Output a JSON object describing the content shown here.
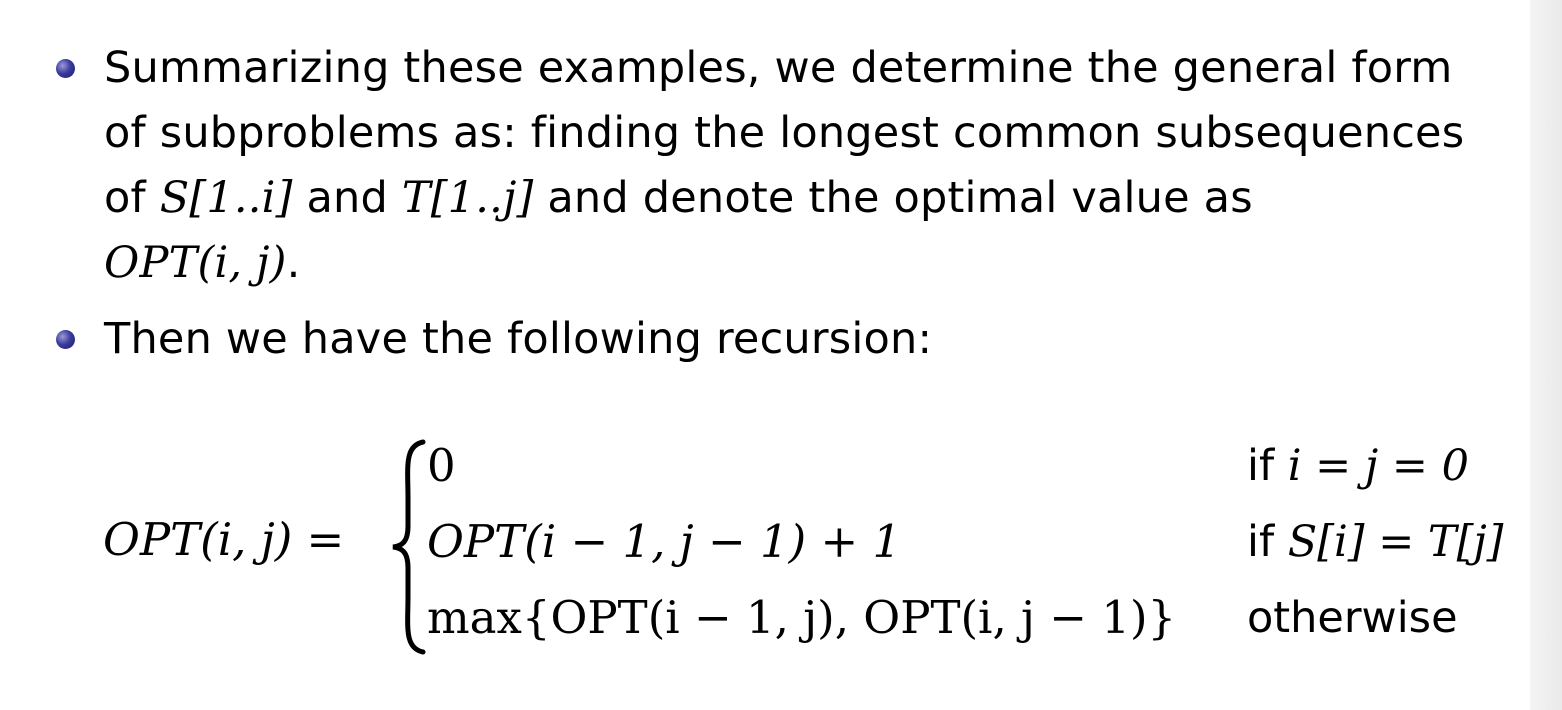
{
  "bullets": [
    {
      "line1": "Summarizing these examples, we determine the general form",
      "line2": "of subproblems as: finding the longest common subsequences",
      "line3_a": "of ",
      "line3_m1": "S[1..i]",
      "line3_b": " and ",
      "line3_m2": "T[1..j]",
      "line3_c": " and denote the optimal value as",
      "line4_m": "OPT(i, j)",
      "line4_end": "."
    },
    {
      "text": "Then we have the following recursion:"
    }
  ],
  "equation": {
    "lhs": "OPT(i, j) =",
    "cases": [
      {
        "expr": "0",
        "cond_word": "if ",
        "cond_math": "i = j = 0"
      },
      {
        "expr": "OPT(i − 1, j − 1) + 1",
        "cond_word": "if ",
        "cond_math": "S[i] = T[j]"
      },
      {
        "expr": "max{OPT(i − 1, j), OPT(i, j − 1)}",
        "cond_word": "otherwise",
        "cond_math": ""
      }
    ]
  }
}
